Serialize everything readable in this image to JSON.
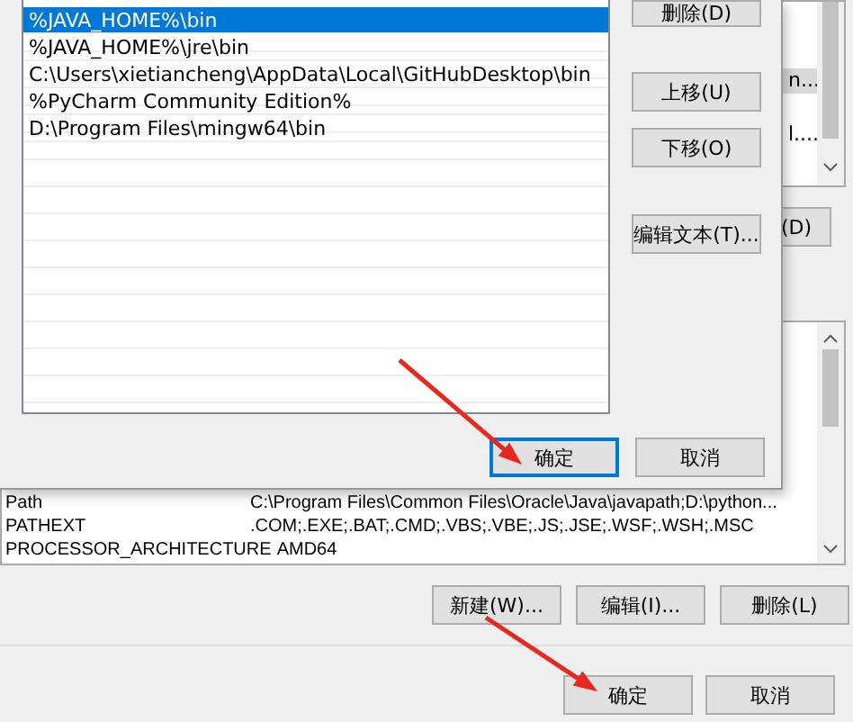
{
  "env_dialog": {
    "user_variables": {
      "rows": [
        {
          "value": "n...",
          "selected": true
        },
        {
          "value": "l....",
          "selected": false
        }
      ]
    },
    "user_delete_button": "(D)",
    "system_variables": {
      "rows": [
        {
          "name": "Path",
          "value": "C:\\Program Files\\Common Files\\Oracle\\Java\\javapath;D:\\python..."
        },
        {
          "name": "PATHEXT",
          "value": ".COM;.EXE;.BAT;.CMD;.VBS;.VBE;.JS;.JSE;.WSF;.WSH;.MSC"
        },
        {
          "name": "PROCESSOR_ARCHITECTURE",
          "value": "AMD64"
        }
      ]
    },
    "system_buttons": [
      "新建(W)...",
      "编辑(I)...",
      "删除(L)"
    ],
    "ok": "确定",
    "cancel": "取消"
  },
  "edit_dialog": {
    "entries": [
      {
        "text": "%JAVA_HOME%\\bin",
        "selected": true
      },
      {
        "text": "%JAVA_HOME%\\jre\\bin",
        "selected": false
      },
      {
        "text": "C:\\Users\\xietiancheng\\AppData\\Local\\GitHubDesktop\\bin",
        "selected": false
      },
      {
        "text": "%PyCharm Community Edition%",
        "selected": false
      },
      {
        "text": "D:\\Program Files\\mingw64\\bin",
        "selected": false
      }
    ],
    "side_buttons": [
      "删除(D)",
      "上移(U)",
      "下移(O)",
      "编辑文本(T)..."
    ],
    "ok": "确定",
    "cancel": "取消"
  }
}
